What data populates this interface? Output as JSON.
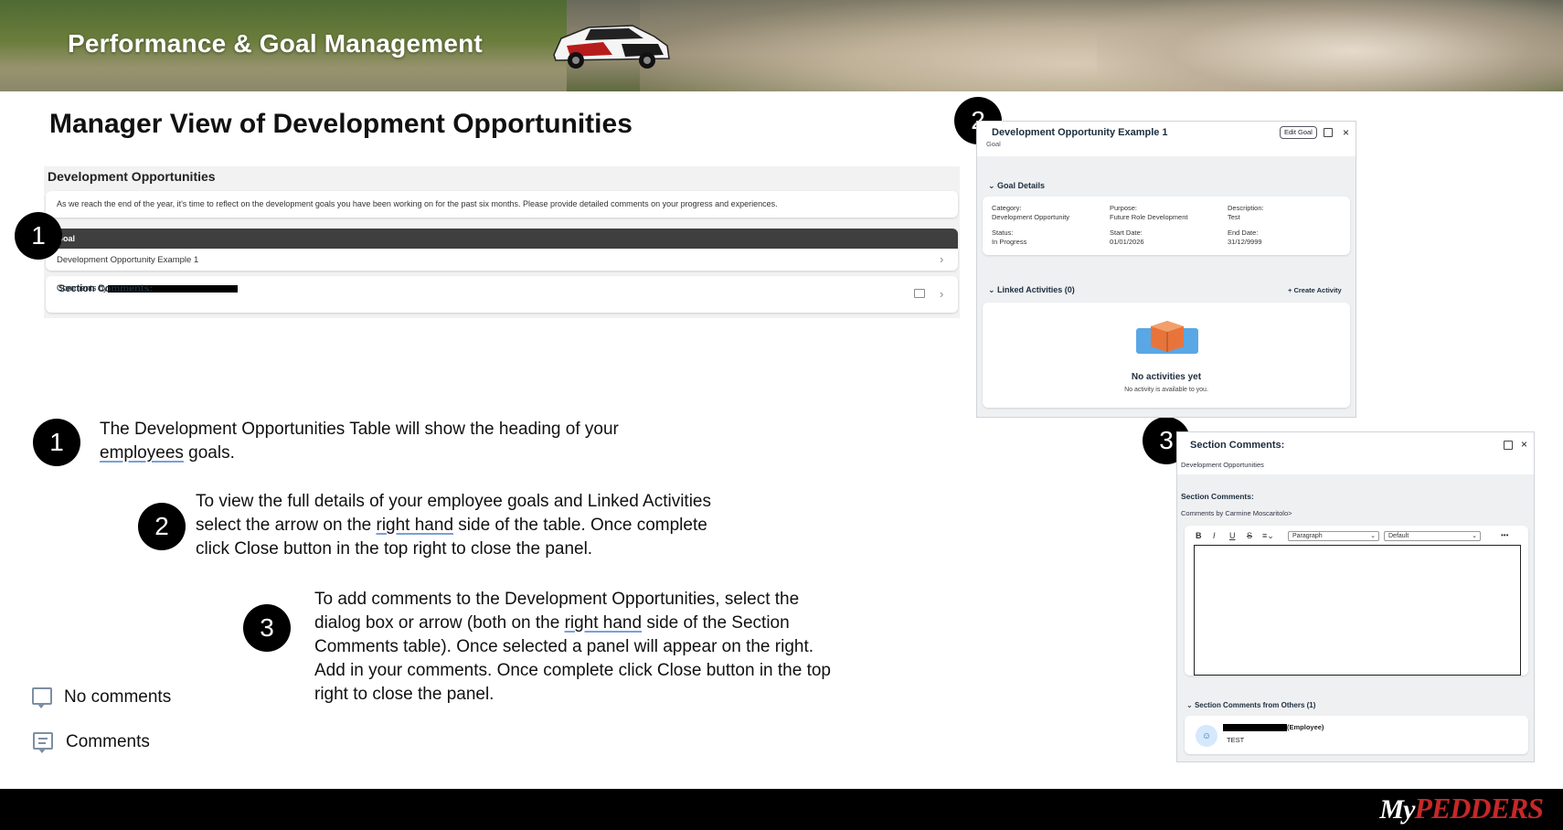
{
  "banner": {
    "title": "Performance & Goal Management"
  },
  "page": {
    "title": "Manager View of Development Opportunities"
  },
  "dev_panel": {
    "heading": "Development Opportunities",
    "intro": "As we reach the end of the year, it's time to reflect on the development goals you have been working on for the past six months. Please provide detailed comments on your progress and experiences.",
    "goal_column": "Goal",
    "goal_row": "Development Opportunity Example 1",
    "section_comments_title": "Section Comments:",
    "section_comments_by": "Comments by"
  },
  "badges": {
    "one": "1",
    "two": "2",
    "three": "3"
  },
  "goal_panel": {
    "title": "Development Opportunity Example 1",
    "subtitle": "Goal",
    "edit_button": "Edit Goal",
    "details_label": "Goal Details",
    "category_label": "Category:",
    "category_value": "Development Opportunity",
    "purpose_label": "Purpose:",
    "purpose_value": "Future Role Development",
    "description_label": "Description:",
    "description_value": "Test",
    "status_label": "Status:",
    "status_value": "In Progress",
    "start_label": "Start Date:",
    "start_value": "01/01/2026",
    "end_label": "End Date:",
    "end_value": "31/12/9999",
    "linked_label": "Linked Activities (0)",
    "create_activity": "Create Activity",
    "empty_title": "No activities yet",
    "empty_sub": "No activity is available to you."
  },
  "comments_panel": {
    "title": "Section Comments:",
    "subtitle": "Development Opportunities",
    "label": "Section Comments:",
    "by_line": "Comments by Carmine Moscaritolo>",
    "toolbar": {
      "bold": "B",
      "italic": "I",
      "underline": "U",
      "strike": "S",
      "paragraph": "Paragraph",
      "font": "Default",
      "more": "•••"
    },
    "others_label": "Section Comments from Others (1)",
    "other_role": "(Employee)",
    "other_text": "TEST"
  },
  "instructions": {
    "one_a": "The Development Opportunities Table will show the heading of your",
    "one_b_u": "employees",
    "one_b_rest": " goals.",
    "two_a": "To view the full details of your employee goals and Linked Activities",
    "two_b_pre": "select the arrow on the ",
    "two_b_u": "right hand",
    "two_b_post": " side of the table. Once complete",
    "two_c": "click Close button in the top right to close the panel.",
    "three_a": "To add comments to the Development Opportunities, select the",
    "three_b_pre": "dialog box or arrow (both on the ",
    "three_b_u": "right hand",
    "three_b_post": " side of the Section",
    "three_c": "Comments table). Once selected a panel will appear on the right.",
    "three_d": "Add in your comments. Once complete click Close button in the top",
    "three_e": "right to close the panel."
  },
  "legend": {
    "no_comments": "No comments",
    "comments": "Comments"
  },
  "footer": {
    "logo_my": "My",
    "logo_brand": "PEDDERS"
  },
  "colors": {
    "footer_bg": "#000000",
    "brand_red": "#c62828",
    "goal_header": "#3f3f3f"
  }
}
